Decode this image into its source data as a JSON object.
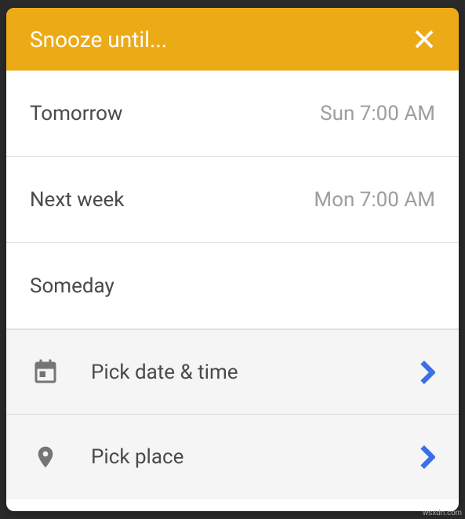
{
  "header": {
    "title": "Snooze until..."
  },
  "options": [
    {
      "label": "Tomorrow",
      "value": "Sun 7:00 AM"
    },
    {
      "label": "Next week",
      "value": "Mon 7:00 AM"
    },
    {
      "label": "Someday",
      "value": ""
    }
  ],
  "picks": [
    {
      "icon": "calendar",
      "label": "Pick date & time"
    },
    {
      "icon": "place",
      "label": "Pick place"
    }
  ],
  "watermark": "wsxdn.com"
}
